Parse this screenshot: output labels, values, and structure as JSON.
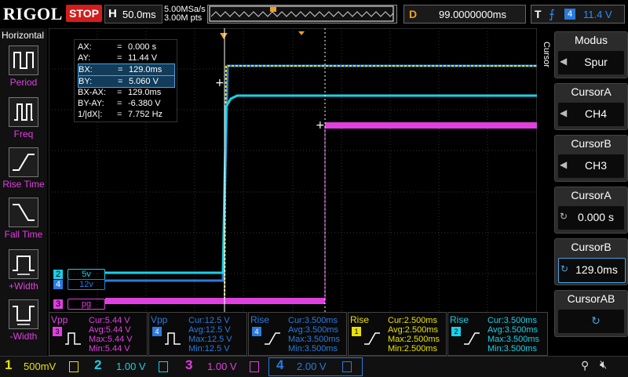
{
  "topbar": {
    "brand": "RIGOL",
    "run_state": "STOP",
    "timebase_letter": "H",
    "timebase": "50.0ms",
    "sample_rate": "5.00MSa/s",
    "memory_depth": "3.00M pts",
    "delay_letter": "D",
    "delay": "99.0000000ms",
    "trigger_letter": "T",
    "trigger_source": "4",
    "trigger_level": "11.4 V"
  },
  "left_panel": {
    "title": "Horizontal",
    "items": [
      {
        "label": "Period",
        "icon": "period-icon"
      },
      {
        "label": "Freq",
        "icon": "frequency-icon"
      },
      {
        "label": "Rise Time",
        "icon": "rise-time-icon"
      },
      {
        "label": "Fall Time",
        "icon": "fall-time-icon"
      },
      {
        "label": "+Width",
        "icon": "positive-width-icon"
      },
      {
        "label": "-Width",
        "icon": "negative-width-icon"
      }
    ]
  },
  "cursor_readout": [
    {
      "key": "AX:",
      "eq": "=",
      "value": "0.000 s"
    },
    {
      "key": "AY:",
      "eq": "=",
      "value": "11.44 V"
    },
    {
      "key": "BX:",
      "eq": "=",
      "value": "129.0ms"
    },
    {
      "key": "BY:",
      "eq": "=",
      "value": "5.060 V"
    },
    {
      "key": "BX-AX:",
      "eq": "=",
      "value": "129.0ms"
    },
    {
      "key": "BY-AY:",
      "eq": "=",
      "value": "-6.380 V"
    },
    {
      "key": "1/|dX|:",
      "eq": "=",
      "value": "7.752 Hz"
    }
  ],
  "channel_tags": {
    "ch2": {
      "num": "2",
      "label": "5v"
    },
    "ch4": {
      "num": "4",
      "label": "12v"
    },
    "ch3": {
      "num": "3",
      "label": "pg"
    }
  },
  "right_menu": {
    "side_title": "Cursor",
    "items": [
      {
        "title": "Modus",
        "value": "Spur",
        "arrow": "◀"
      },
      {
        "title": "CursorA",
        "value": "CH4",
        "arrow": "◀"
      },
      {
        "title": "CursorB",
        "value": "CH3",
        "arrow": "◀"
      },
      {
        "title": "CursorA",
        "value": "0.000 s",
        "arrow": "↻"
      },
      {
        "title": "CursorB",
        "value": "129.0ms",
        "arrow": "↻"
      },
      {
        "title": "CursorAB",
        "value": "↻",
        "arrow": ""
      }
    ]
  },
  "measurements": [
    {
      "name": "Vpp",
      "src": "3",
      "cur": "Cur:5.44 V",
      "avg": "Avg:5.44 V",
      "max": "Max:5.44 V",
      "min": "Min:5.44 V",
      "color": "#e040e0"
    },
    {
      "name": "Vpp",
      "src": "4",
      "cur": "Cur:12.5 V",
      "avg": "Avg:12.5 V",
      "max": "Max:12.5 V",
      "min": "Min:12.5 V",
      "color": "#2a7bde"
    },
    {
      "name": "Rise",
      "src": "4",
      "cur": "Cur:3.500ms",
      "avg": "Avg:3.500ms",
      "max": "Max:3.500ms",
      "min": "Min:3.500ms",
      "color": "#2a7bde"
    },
    {
      "name": "Rise",
      "src": "1",
      "cur": "Cur:2.500ms",
      "avg": "Avg:2.500ms",
      "max": "Max:2.500ms",
      "min": "Min:2.500ms",
      "color": "#e8e000"
    },
    {
      "name": "Rise",
      "src": "2",
      "cur": "Cur:3.500ms",
      "avg": "Avg:3.500ms",
      "max": "Max:3.500ms",
      "min": "Min:3.500ms",
      "color": "#19d0e8"
    }
  ],
  "channels": [
    {
      "num": "1",
      "scale": "500mV",
      "color": "#e8e000"
    },
    {
      "num": "2",
      "scale": "1.00 V",
      "color": "#19d0e8"
    },
    {
      "num": "3",
      "scale": "1.00 V",
      "color": "#e040e0"
    },
    {
      "num": "4",
      "scale": "2.00 V",
      "color": "#2a7bde"
    }
  ],
  "colors": {
    "ch1": "#e8e000",
    "ch2": "#19d0e8",
    "ch3": "#e040e0",
    "ch4": "#2a7bde",
    "stop": "#d21d1d",
    "trigger_marker": "#f0a020"
  }
}
